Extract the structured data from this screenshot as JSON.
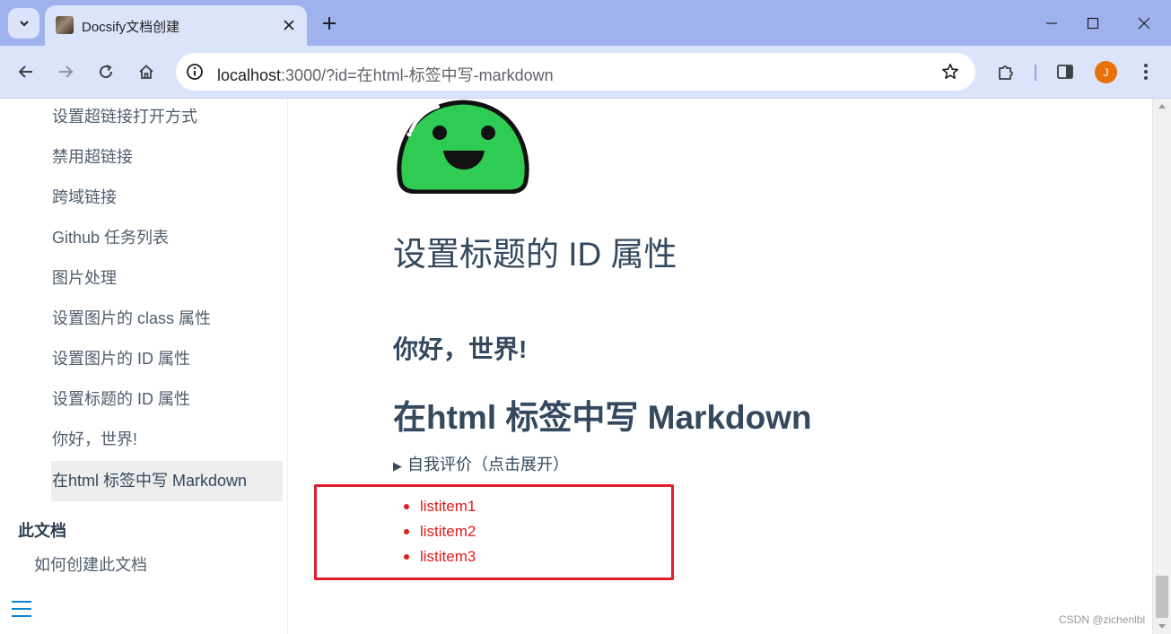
{
  "browser": {
    "tab_title": "Docsify文档创建",
    "url_host": "localhost",
    "url_rest": ":3000/?id=在html-标签中写-markdown",
    "avatar_letter": "J",
    "icons": {
      "tab_search": "chevron-down-icon",
      "close": "close-icon",
      "new_tab": "plus-icon",
      "back": "arrow-left-icon",
      "forward": "arrow-right-icon",
      "reload": "reload-icon",
      "home": "home-icon",
      "info": "info-icon",
      "star": "star-icon",
      "extensions": "puzzle-icon",
      "side_panel": "side-panel-icon",
      "menu": "kebab-menu-icon"
    }
  },
  "sidebar": {
    "items": [
      {
        "label": "设置超链接打开方式"
      },
      {
        "label": "禁用超链接"
      },
      {
        "label": "跨域链接"
      },
      {
        "label": "Github 任务列表"
      },
      {
        "label": "图片处理"
      },
      {
        "label": "设置图片的 class 属性"
      },
      {
        "label": "设置图片的 ID 属性"
      },
      {
        "label": "设置标题的 ID 属性"
      },
      {
        "label": "你好，世界!"
      },
      {
        "label": "在html 标签中写 Markdown",
        "active": true
      }
    ],
    "section_title": "此文档",
    "section_item": "如何创建此文档"
  },
  "content": {
    "heading_id_attr": "设置标题的 ID 属性",
    "heading_hello": "你好，世界!",
    "heading_markdown": "在html 标签中写 Markdown",
    "details_summary": "自我评价（点击展开）",
    "list_items": [
      "listitem1",
      "listitem2",
      "listitem3"
    ]
  },
  "watermark": "CSDN @zichenlbl",
  "colors": {
    "tabstrip": "#9eb2ee",
    "toolbar": "#dce4fb",
    "highlight": "#e11d2a",
    "list_text": "#e01b1b",
    "heading": "#34495e",
    "avatar": "#e8710a"
  }
}
